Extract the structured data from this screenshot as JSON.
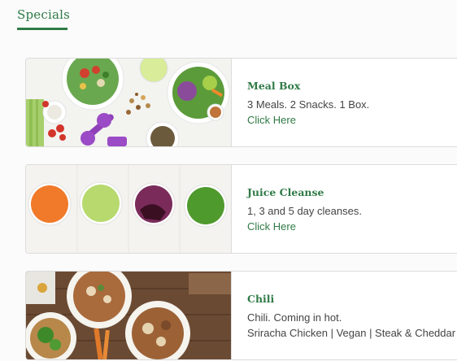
{
  "page": {
    "tab_title": "Specials"
  },
  "specials": [
    {
      "name": "Meal Box",
      "description": "3 Meals. 2 Snacks. 1 Box.",
      "link_text": "Click Here"
    },
    {
      "name": "Juice Cleanse",
      "description": "1, 3 and 5 day cleanses.",
      "link_text": "Click Here"
    },
    {
      "name": "Chili",
      "description": "Chili. Coming in hot.",
      "description2": "Sriracha Chicken | Vegan | Steak & Cheddar"
    }
  ],
  "colors": {
    "accent": "#2f7a46",
    "text": "#444444",
    "border": "#dcdcdc"
  }
}
